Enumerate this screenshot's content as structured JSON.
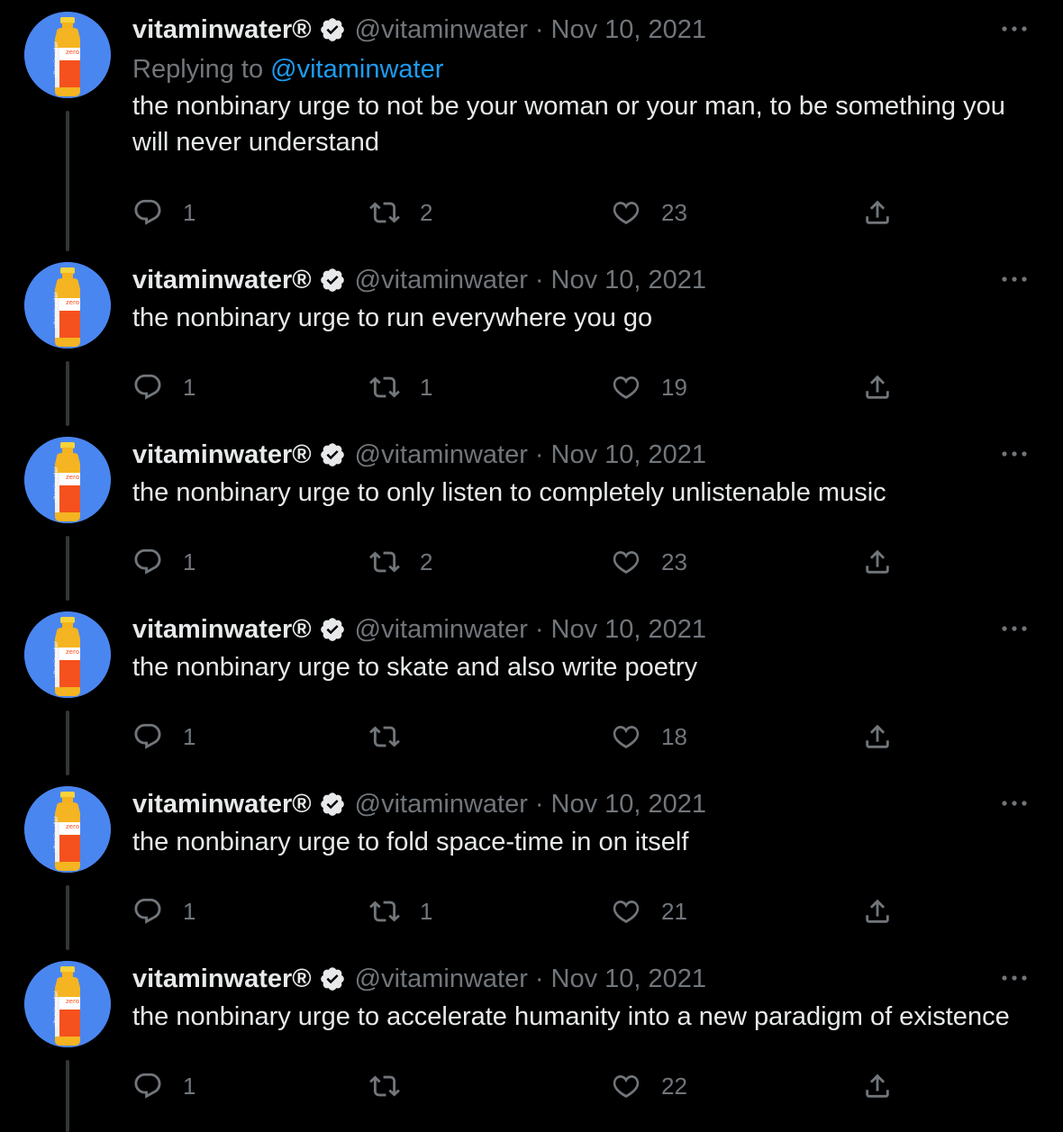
{
  "author": {
    "name": "vitaminwater®",
    "handle": "@vitaminwater",
    "verified": true
  },
  "colors": {
    "background": "#000000",
    "text": "#e7e9ea",
    "muted": "#71767b",
    "link": "#1d9bf0",
    "avatar_bg": "#4a86f0"
  },
  "icons": [
    "verified-badge-icon",
    "more-icon",
    "reply-icon",
    "retweet-icon",
    "like-icon",
    "share-icon"
  ],
  "tweets": [
    {
      "date": "Nov 10, 2021",
      "replying_prefix": "Replying to ",
      "replying_to": "@vitaminwater",
      "text": "the nonbinary urge to not be your woman or your man, to be something you\nwill never understand",
      "replies": "1",
      "retweets": "2",
      "likes": "23"
    },
    {
      "date": "Nov 10, 2021",
      "text": "the nonbinary urge to run everywhere you go",
      "replies": "1",
      "retweets": "1",
      "likes": "19"
    },
    {
      "date": "Nov 10, 2021",
      "text": "the nonbinary urge to only listen to completely unlistenable music",
      "replies": "1",
      "retweets": "2",
      "likes": "23"
    },
    {
      "date": "Nov 10, 2021",
      "text": "the nonbinary urge to skate and also write poetry",
      "replies": "1",
      "retweets": "",
      "likes": "18"
    },
    {
      "date": "Nov 10, 2021",
      "text": "the nonbinary urge to fold space-time in on itself",
      "replies": "1",
      "retweets": "1",
      "likes": "21"
    },
    {
      "date": "Nov 10, 2021",
      "text": "the nonbinary urge to accelerate humanity into a new paradigm of existence",
      "replies": "1",
      "retweets": "",
      "likes": "22"
    }
  ]
}
